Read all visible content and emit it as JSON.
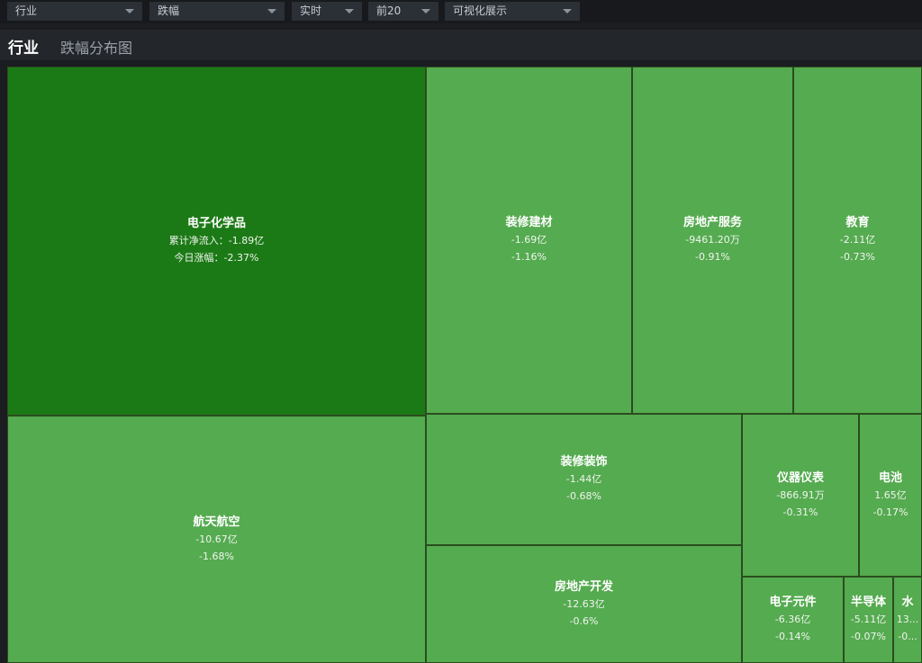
{
  "filters": [
    {
      "value": "行业"
    },
    {
      "value": "跌幅"
    },
    {
      "value": "实时"
    },
    {
      "value": "前20"
    },
    {
      "value": "可视化展示"
    }
  ],
  "header": {
    "title": "行业",
    "subtitle": "跌幅分布图"
  },
  "colors": {
    "dark_green": "#1c7a16",
    "light_green": "#55ab50"
  },
  "chart_data": {
    "type": "treemap",
    "items": [
      {
        "name": "电子化学品",
        "line1": "累计净流入：-1.89亿",
        "line2": "今日涨幅：-2.37%",
        "net_inflow": "-1.89亿",
        "change": "-2.37%",
        "color": "#1c7a16"
      },
      {
        "name": "装修建材",
        "line1": "-1.69亿",
        "line2": "-1.16%",
        "net_inflow": "-1.69亿",
        "change": "-1.16%",
        "color": "#55ab50"
      },
      {
        "name": "房地产服务",
        "line1": "-9461.20万",
        "line2": "-0.91%",
        "net_inflow": "-9461.20万",
        "change": "-0.91%",
        "color": "#55ab50"
      },
      {
        "name": "教育",
        "line1": "-2.11亿",
        "line2": "-0.73%",
        "net_inflow": "-2.11亿",
        "change": "-0.73%",
        "color": "#55ab50"
      },
      {
        "name": "航天航空",
        "line1": "-10.67亿",
        "line2": "-1.68%",
        "net_inflow": "-10.67亿",
        "change": "-1.68%",
        "color": "#55ab50"
      },
      {
        "name": "装修装饰",
        "line1": "-1.44亿",
        "line2": "-0.68%",
        "net_inflow": "-1.44亿",
        "change": "-0.68%",
        "color": "#55ab50"
      },
      {
        "name": "仪器仪表",
        "line1": "-866.91万",
        "line2": "-0.31%",
        "net_inflow": "-866.91万",
        "change": "-0.31%",
        "color": "#55ab50"
      },
      {
        "name": "电池",
        "line1": "1.65亿",
        "line2": "-0.17%",
        "net_inflow": "1.65亿",
        "change": "-0.17%",
        "color": "#55ab50"
      },
      {
        "name": "房地产开发",
        "line1": "-12.63亿",
        "line2": "-0.6%",
        "net_inflow": "-12.63亿",
        "change": "-0.6%",
        "color": "#55ab50"
      },
      {
        "name": "电子元件",
        "line1": "-6.36亿",
        "line2": "-0.14%",
        "net_inflow": "-6.36亿",
        "change": "-0.14%",
        "color": "#55ab50"
      },
      {
        "name": "半导体",
        "line1": "-5.11亿",
        "line2": "-0.07%",
        "net_inflow": "-5.11亿",
        "change": "-0.07%",
        "color": "#55ab50"
      },
      {
        "name": "水",
        "line1": "13...",
        "line2": "-0...",
        "net_inflow": "13...",
        "change": "-0...",
        "color": "#55ab50"
      }
    ]
  }
}
